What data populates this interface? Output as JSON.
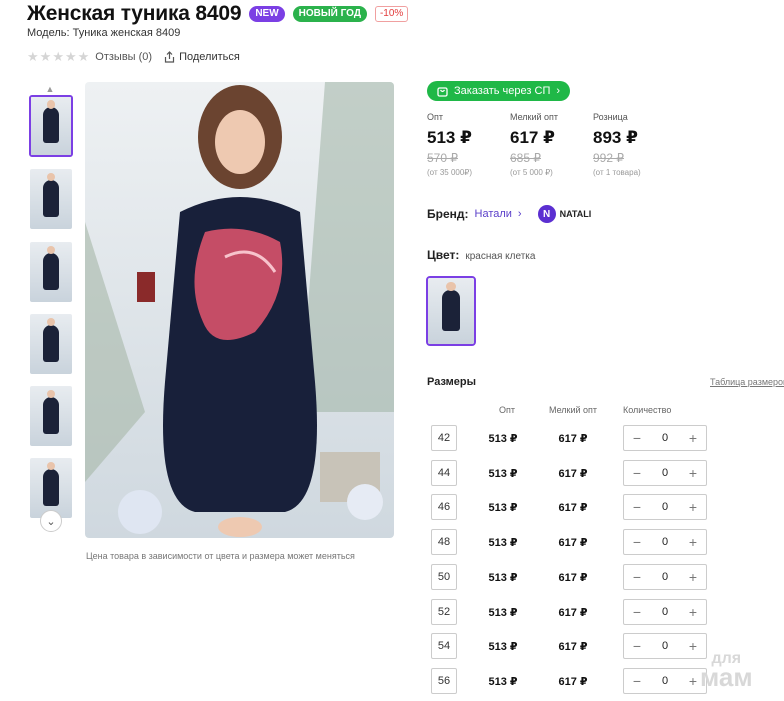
{
  "product": {
    "title": "Женская туника 8409",
    "badges": {
      "new": "NEW",
      "new_year": "НОВЫЙ ГОД",
      "discount": "-10%"
    },
    "model": "Модель: Туника женская 8409",
    "reviews": "Отзывы (0)",
    "share": "Поделиться",
    "rating": 0,
    "rating_max": 5
  },
  "gallery": {
    "caption": "Цена товара в зависимости от цвета и размера может меняться",
    "thumb_count": 6
  },
  "order_button": "Заказать через СП",
  "prices": [
    {
      "label": "Опт",
      "price": "513 ₽",
      "old": "570 ₽",
      "note": "(от 35 000₽)"
    },
    {
      "label": "Мелкий опт",
      "price": "617 ₽",
      "old": "685 ₽",
      "note": "(от 5 000 ₽)"
    },
    {
      "label": "Розница",
      "price": "893 ₽",
      "old": "992 ₽",
      "note": "(от 1 товара)"
    }
  ],
  "brand": {
    "label": "Бренд:",
    "name": "Натали",
    "logo_text": "NATALI"
  },
  "color": {
    "label": "Цвет:",
    "value": "красная клетка"
  },
  "sizes": {
    "title": "Размеры",
    "chart_link": "Таблица размеров",
    "headers": {
      "opt": "Опт",
      "small": "Мелкий опт",
      "qty": "Количество"
    },
    "rows": [
      {
        "size": "42",
        "opt": "513 ₽",
        "small": "617 ₽",
        "qty": "0"
      },
      {
        "size": "44",
        "opt": "513 ₽",
        "small": "617 ₽",
        "qty": "0"
      },
      {
        "size": "46",
        "opt": "513 ₽",
        "small": "617 ₽",
        "qty": "0"
      },
      {
        "size": "48",
        "opt": "513 ₽",
        "small": "617 ₽",
        "qty": "0"
      },
      {
        "size": "50",
        "opt": "513 ₽",
        "small": "617 ₽",
        "qty": "0"
      },
      {
        "size": "52",
        "opt": "513 ₽",
        "small": "617 ₽",
        "qty": "0"
      },
      {
        "size": "54",
        "opt": "513 ₽",
        "small": "617 ₽",
        "qty": "0"
      },
      {
        "size": "56",
        "opt": "513 ₽",
        "small": "617 ₽",
        "qty": "0"
      }
    ]
  },
  "watermark": {
    "line1": "для",
    "line2": "мам"
  },
  "colors": {
    "accent": "#7b3fe4",
    "green": "#1fb847",
    "link": "#5a3fc9"
  }
}
